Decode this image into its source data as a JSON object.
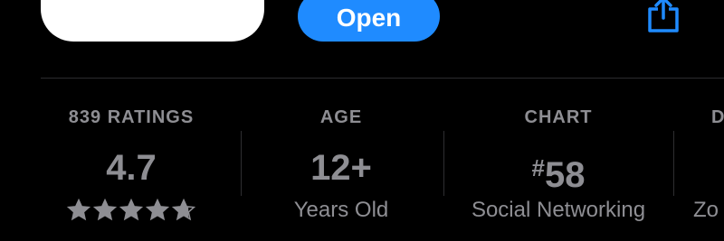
{
  "header": {
    "open_label": "Open",
    "accent": "#1f8bff",
    "share_icon": "share-icon"
  },
  "info": {
    "ratings": {
      "header": "839 RATINGS",
      "value": "4.7",
      "stars_value": 4.7,
      "stars_max": 5
    },
    "age": {
      "header": "AGE",
      "value": "12+",
      "sub": "Years Old"
    },
    "chart": {
      "header": "CHART",
      "hash": "#",
      "value": "58",
      "sub": "Social Networking"
    },
    "developer": {
      "header": "D",
      "sub": "Zo"
    }
  },
  "colors": {
    "background": "#000000",
    "secondary_text": "#8e8e93",
    "separator": "#2e2e31"
  }
}
